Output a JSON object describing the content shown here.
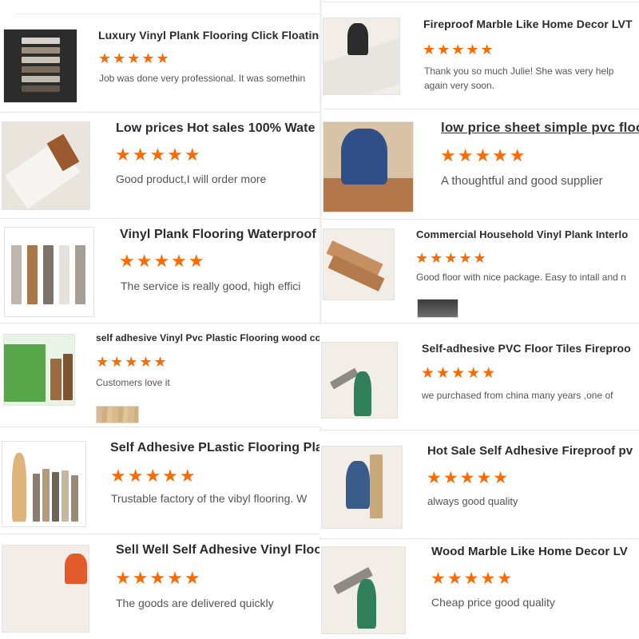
{
  "star_color": "#ff6a00",
  "star_glyph": "★★★★★",
  "left": [
    {
      "title": "Luxury Vinyl Plank Flooring Click Floating",
      "review": "Job was done very professional. It was somethin",
      "thumb": "vinyl-plank-samples-image"
    },
    {
      "title": "Low prices Hot sales 100% Wate",
      "review": "Good product,I will order more",
      "thumb": "peel-tape-roll-image"
    },
    {
      "title": "Vinyl Plank Flooring Waterproof",
      "review": "The service is really good, high effici",
      "thumb": "five-plank-swatches-image"
    },
    {
      "title": "self adhesive Vinyl Pvc Plastic Flooring wood co",
      "review": "Customers love it",
      "thumb": "catalog-planks-image"
    },
    {
      "title": "Self Adhesive PLastic Flooring Plai",
      "review": "Trustable factory of the vibyl flooring. W",
      "thumb": "model-with-planks-image"
    },
    {
      "title": "Sell Well Self Adhesive Vinyl Floo",
      "review": "The goods are delivered quickly",
      "thumb": "installer-wood-floor-image"
    }
  ],
  "right": [
    {
      "title": "Fireproof Marble Like Home Decor LVT",
      "review_lines": [
        "Thank you so much Julie! She was very help",
        "again very soon."
      ],
      "thumb": "installing-floor-image"
    },
    {
      "title": "low price sheet simple pvc floo",
      "review": "A thoughtful and good supplier",
      "thumb": "worker-kneeling-image"
    },
    {
      "title": "Commercial Household Vinyl Plank Interlo",
      "review": "Good floor with nice package. Easy to intall and n",
      "thumb": "stacked-wood-planks-image"
    },
    {
      "title": "Self-adhesive PVC Floor Tiles Fireproo",
      "review": "we purchased from china many years ,one of",
      "thumb": "warehouse-worker-image"
    },
    {
      "title": "Hot Sale Self Adhesive Fireproof pv",
      "review": "always good quality",
      "thumb": "factory-staff-image"
    },
    {
      "title": "Wood Marble Like Home Decor LV",
      "review": "Cheap price good quality",
      "thumb": "warehouse-worker-plank-image"
    }
  ]
}
